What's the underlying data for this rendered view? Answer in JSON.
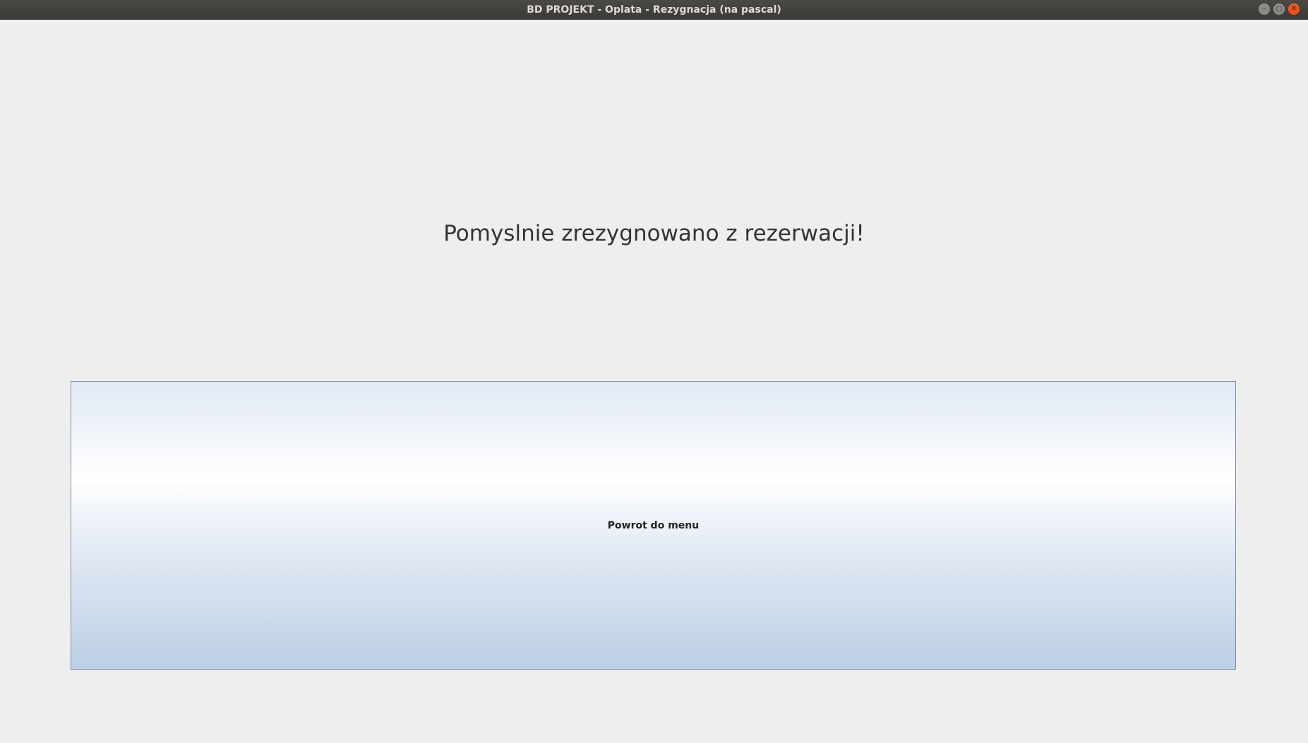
{
  "window": {
    "title": "BD PROJEKT - Oplata - Rezygnacja (na pascal)",
    "controls": {
      "minimize_icon": "minimize-icon",
      "maximize_icon": "maximize-icon",
      "close_icon": "close-icon"
    }
  },
  "main": {
    "message": "Pomyslnie zrezygnowano z rezerwacji!",
    "back_button_label": "Powrot do menu"
  },
  "colors": {
    "titlebar": "#3c3b37",
    "background": "#eeeeee",
    "close_button": "#e9541f",
    "button_border": "#7a8ea8"
  }
}
